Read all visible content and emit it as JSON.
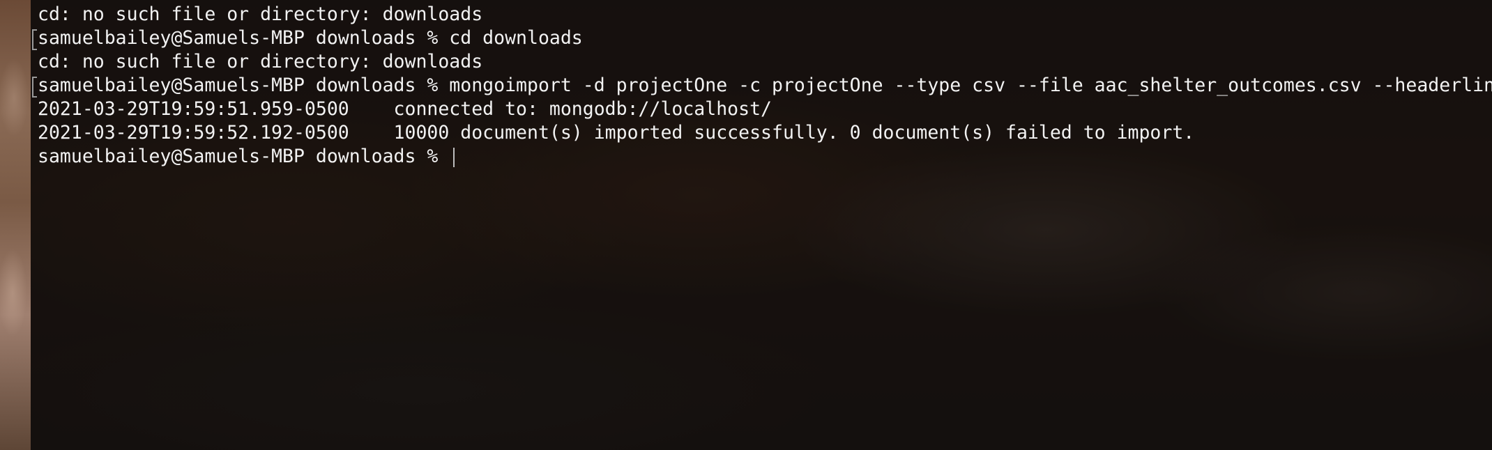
{
  "terminal": {
    "lines": [
      {
        "text": "cd: no such file or directory: downloads",
        "marked": false
      },
      {
        "text": "samuelbailey@Samuels-MBP downloads % cd downloads",
        "marked": true
      },
      {
        "text": "cd: no such file or directory: downloads",
        "marked": false
      },
      {
        "text": "samuelbailey@Samuels-MBP downloads % mongoimport -d projectOne -c projectOne --type csv --file aac_shelter_outcomes.csv --headerlin",
        "marked": true
      },
      {
        "text": "2021-03-29T19:59:51.959-0500    connected to: mongodb://localhost/",
        "marked": false
      },
      {
        "text": "2021-03-29T19:59:52.192-0500    10000 document(s) imported successfully. 0 document(s) failed to import.",
        "marked": false
      }
    ],
    "prompt": "samuelbailey@Samuels-MBP downloads % "
  }
}
